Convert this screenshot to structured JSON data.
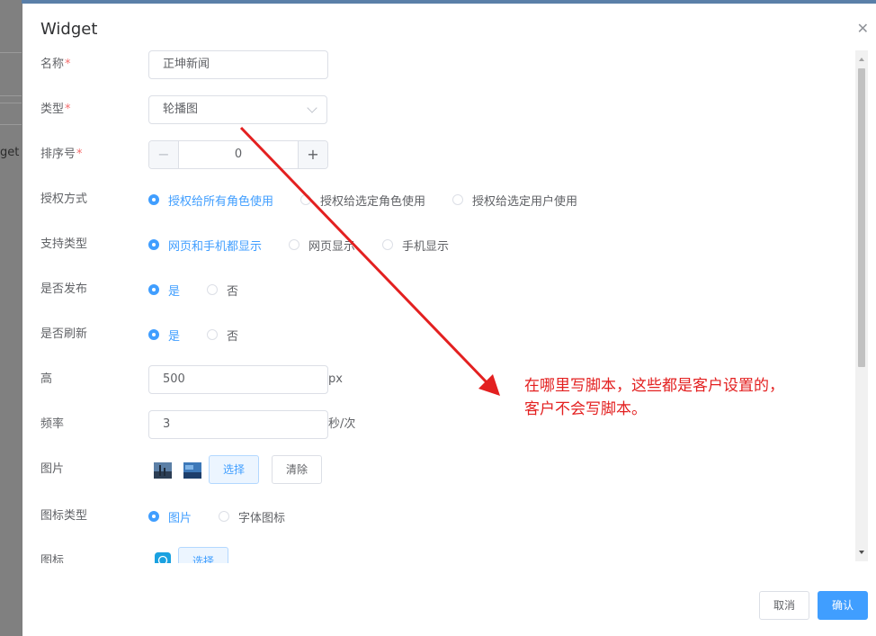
{
  "background": {
    "left_fragment": "get"
  },
  "dialog": {
    "title": "Widget",
    "close_icon": "close-icon",
    "fields": {
      "name": {
        "label": "名称",
        "required_mark": "*",
        "value": "正坤新闻"
      },
      "type": {
        "label": "类型",
        "required_mark": "*",
        "value": "轮播图"
      },
      "order": {
        "label": "排序号",
        "required_mark": "*",
        "value": "0",
        "minus": "−",
        "plus": "+"
      },
      "auth": {
        "label": "授权方式",
        "options": [
          "授权给所有角色使用",
          "授权给选定角色使用",
          "授权给选定用户使用"
        ],
        "selected": 0
      },
      "support": {
        "label": "支持类型",
        "options": [
          "网页和手机都显示",
          "网页显示",
          "手机显示"
        ],
        "selected": 0
      },
      "publish": {
        "label": "是否发布",
        "options": [
          "是",
          "否"
        ],
        "selected": 0
      },
      "refresh": {
        "label": "是否刷新",
        "options": [
          "是",
          "否"
        ],
        "selected": 0
      },
      "height": {
        "label": "高",
        "value": "500",
        "suffix": "px"
      },
      "frequency": {
        "label": "频率",
        "value": "3",
        "suffix": "秒/次"
      },
      "image": {
        "label": "图片",
        "select_label": "选择",
        "clear_label": "清除"
      },
      "icon_type": {
        "label": "图标类型",
        "options": [
          "图片",
          "字体图标"
        ],
        "selected": 0
      },
      "icon": {
        "label": "图标",
        "select_label": "选择"
      }
    },
    "footer": {
      "cancel_label": "取消",
      "ok_label": "确认"
    }
  },
  "annotation": {
    "line1": "在哪里写脚本，这些都是客户设置的，",
    "line2": "客户不会写脚本。",
    "color": "#e32020"
  },
  "colors": {
    "accent": "#409eff",
    "required": "#f56c6c"
  }
}
